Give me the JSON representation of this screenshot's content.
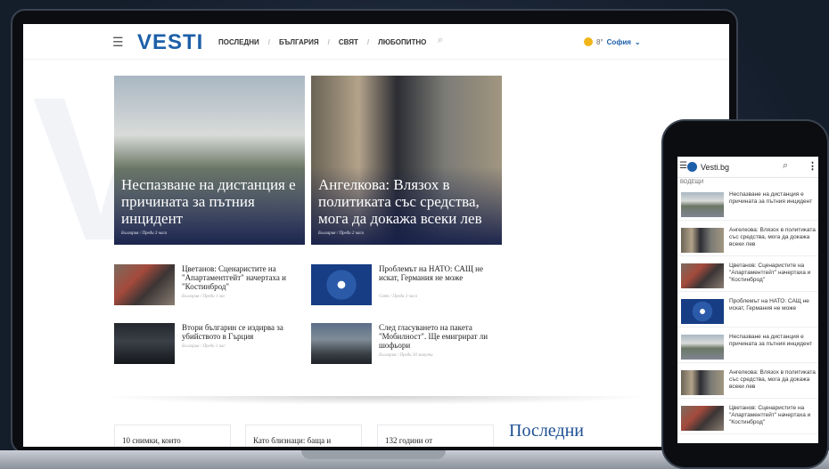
{
  "site": {
    "logo": "VESTI",
    "burger_icon": "☰",
    "search_icon": "⌕"
  },
  "nav": {
    "items": [
      "ПОСЛЕДНИ",
      "БЪЛГАРИЯ",
      "СВЯТ",
      "ЛЮБОПИТНО"
    ],
    "separator": "/"
  },
  "weather": {
    "temp": "8°",
    "city": "София",
    "chevron_icon": "⌄",
    "sun_color": "#f2b51a"
  },
  "featured": [
    {
      "title": "Неспазване на дистанция е причината за пътния инцидент",
      "meta": "България / Преди 3 часа"
    },
    {
      "title": "Ангелкова: Влязох в политиката със средства, мога да докажа всеки лев",
      "meta": "България / Преди 2 часа"
    }
  ],
  "stories": [
    {
      "title": "Цветанов: Сценаристите на \"Апартаментгейт\" начертаха и \"Костинброд\"",
      "meta": "България / Преди 1 час"
    },
    {
      "title": "Проблемът на НАТО: САЩ не искат, Германия не може",
      "meta": "Свят / Преди 3 часа"
    },
    {
      "title": "Втори българин се издирва за убийството в Гърция",
      "meta": "България / Преди 1 час"
    },
    {
      "title": "След гласуването на пакета \"Мобилност\". Ще емигрират ли шофьори",
      "meta": "България / Преди 30 минути"
    }
  ],
  "bottom": {
    "items": [
      "10 снимки, които",
      "Като близнаци: баща и",
      "132 години от"
    ],
    "latest_heading": "Последни"
  },
  "phone": {
    "title": "Vesti.bg",
    "search_icon": "⌕",
    "more_icon": "⋮",
    "section": "ВОДЕЩИ",
    "items": [
      "Неспазване на дистанция е причината за пътния инцидент",
      "Ангелкова: Влязох в политиката със средства, мога да докажа всеки лев",
      "Цветанов: Сценаристите на \"Апартаментгейт\" начертаха и \"Костинброд\"",
      "Проблемът на НАТО: САЩ не искат, Германия не може",
      "Неспазване на дистанция е причината за пътния инцидент",
      "Ангелкова: Влязох в политиката със средства, мога да докажа всеки лев",
      "Цветанов: Сценаристите на \"Апартаментгейт\" начертаха и \"Костинброд\""
    ]
  },
  "colors": {
    "brand": "#1d5fa8",
    "hero_overlay": "#16204a",
    "background": "#141d2a"
  }
}
